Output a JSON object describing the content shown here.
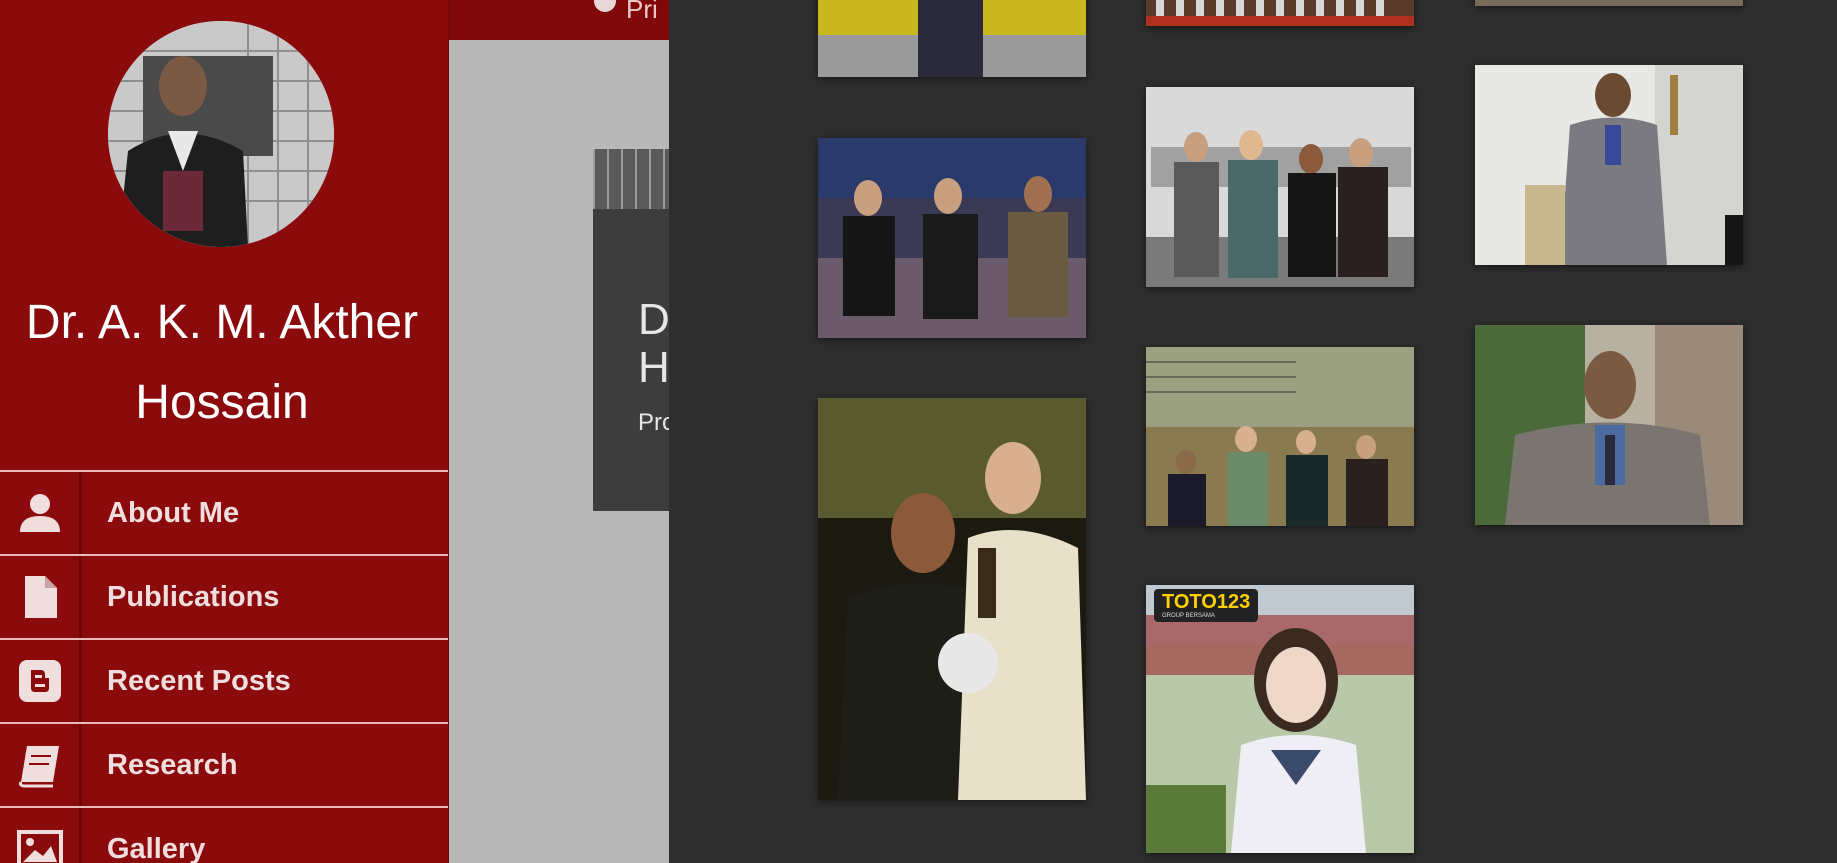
{
  "sidebar": {
    "profile_name": "Dr. A. K. M. Akther Hossain",
    "nav": [
      {
        "label": "About Me",
        "icon": "user-icon"
      },
      {
        "label": "Publications",
        "icon": "document-icon"
      },
      {
        "label": "Recent Posts",
        "icon": "blogger-icon"
      },
      {
        "label": "Research",
        "icon": "book-icon"
      },
      {
        "label": "Gallery",
        "icon": "image-icon"
      }
    ]
  },
  "topbar": {
    "partial_label": "Pri"
  },
  "hero": {
    "title_partial": [
      "D",
      "H"
    ],
    "subtitle_partial": "Pro"
  },
  "gallery": {
    "badge_text": "TOTO123",
    "badge_subtext": "GROUP BERSAMA"
  },
  "colors": {
    "sidebar_bg": "#8b0a0b",
    "overlay_bg": "#2e2e2e",
    "nav_text": "#f0dede"
  }
}
